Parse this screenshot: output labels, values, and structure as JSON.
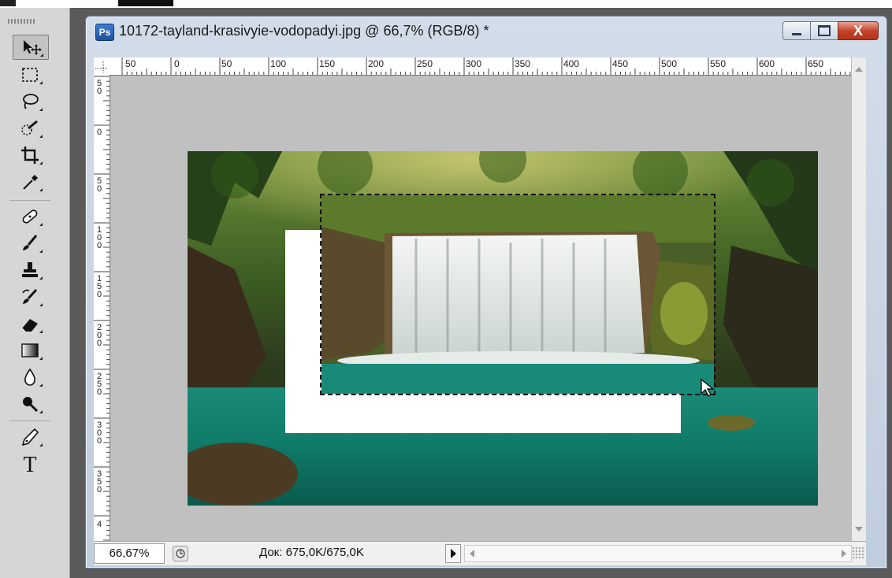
{
  "document": {
    "title": "10172-tayland-krasivyie-vodopadyi.jpg @ 66,7% (RGB/8) *",
    "app_icon_label": "Ps",
    "close_label": "X"
  },
  "ruler": {
    "horizontal": [
      "50",
      "0",
      "50",
      "100",
      "150",
      "200",
      "250",
      "300",
      "350",
      "400",
      "450",
      "500",
      "550",
      "600",
      "650"
    ],
    "vertical": [
      "50",
      "0",
      "50",
      "100",
      "150",
      "200",
      "250",
      "300",
      "350",
      "4"
    ]
  },
  "status": {
    "zoom": "66,67%",
    "doc_size": "Док: 675,0K/675,0K"
  },
  "tools": [
    {
      "name": "move-tool",
      "icon": "move-icon"
    },
    {
      "name": "marquee-tool",
      "icon": "rect-marquee-icon"
    },
    {
      "name": "lasso-tool",
      "icon": "lasso-icon"
    },
    {
      "name": "quick-selection-tool",
      "icon": "quick-select-icon"
    },
    {
      "name": "crop-tool",
      "icon": "crop-icon"
    },
    {
      "name": "eyedropper-tool",
      "icon": "eyedropper-icon"
    },
    {
      "name": "healing-brush-tool",
      "icon": "bandage-icon"
    },
    {
      "name": "brush-tool",
      "icon": "brush-icon"
    },
    {
      "name": "clone-stamp-tool",
      "icon": "stamp-icon"
    },
    {
      "name": "history-brush-tool",
      "icon": "history-brush-icon"
    },
    {
      "name": "eraser-tool",
      "icon": "eraser-icon"
    },
    {
      "name": "gradient-tool",
      "icon": "gradient-icon"
    },
    {
      "name": "blur-tool",
      "icon": "drop-icon"
    },
    {
      "name": "dodge-tool",
      "icon": "dodge-icon"
    },
    {
      "name": "pen-tool",
      "icon": "pen-icon"
    },
    {
      "name": "type-tool",
      "icon": "type-icon",
      "label": "T"
    }
  ]
}
